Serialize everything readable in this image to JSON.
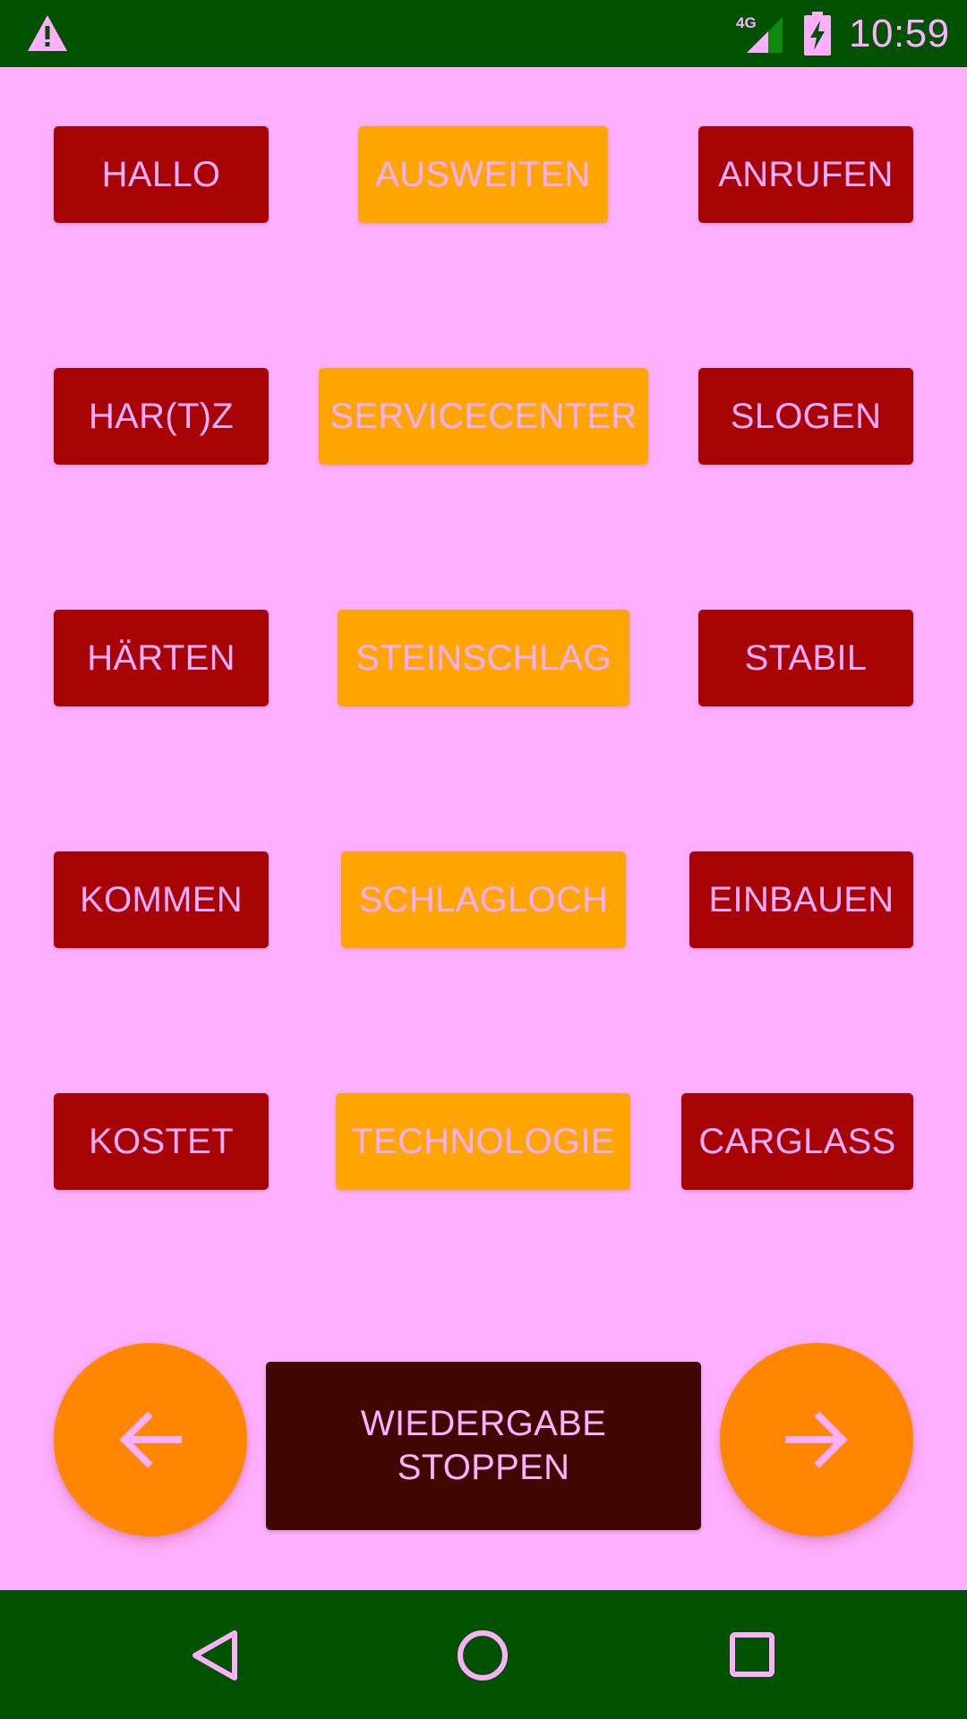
{
  "status_bar": {
    "time": "10:59",
    "network": "4G",
    "icons": [
      "warning-icon",
      "signal-4g-icon",
      "battery-charging-icon"
    ]
  },
  "colors": {
    "background": "#FFAFFF",
    "bar_green": "#005200",
    "button_red": "#A90404",
    "button_orange": "#FFA500",
    "fab_orange": "#FF8600",
    "stop_dark": "#3F0700",
    "text_pink": "#FFAFFF"
  },
  "words": {
    "row1": [
      "HALLO",
      "AUSWEITEN",
      "ANRUFEN"
    ],
    "row2": [
      "HAR(T)Z",
      "SERVICECENTER",
      "SLOGEN"
    ],
    "row3": [
      "HÄRTEN",
      "STEINSCHLAG",
      "STABIL"
    ],
    "row4": [
      "KOMMEN",
      "SCHLAGLOCH",
      "EINBAUEN"
    ],
    "row5": [
      "KOSTET",
      "TECHNOLOGIE",
      "CARGLASS"
    ]
  },
  "controls": {
    "stop_line1": "WIEDERGABE",
    "stop_line2": "STOPPEN",
    "prev_icon": "arrow-left-icon",
    "next_icon": "arrow-right-icon"
  },
  "nav_bar": {
    "icons": [
      "back-icon",
      "home-icon",
      "recents-icon"
    ]
  }
}
